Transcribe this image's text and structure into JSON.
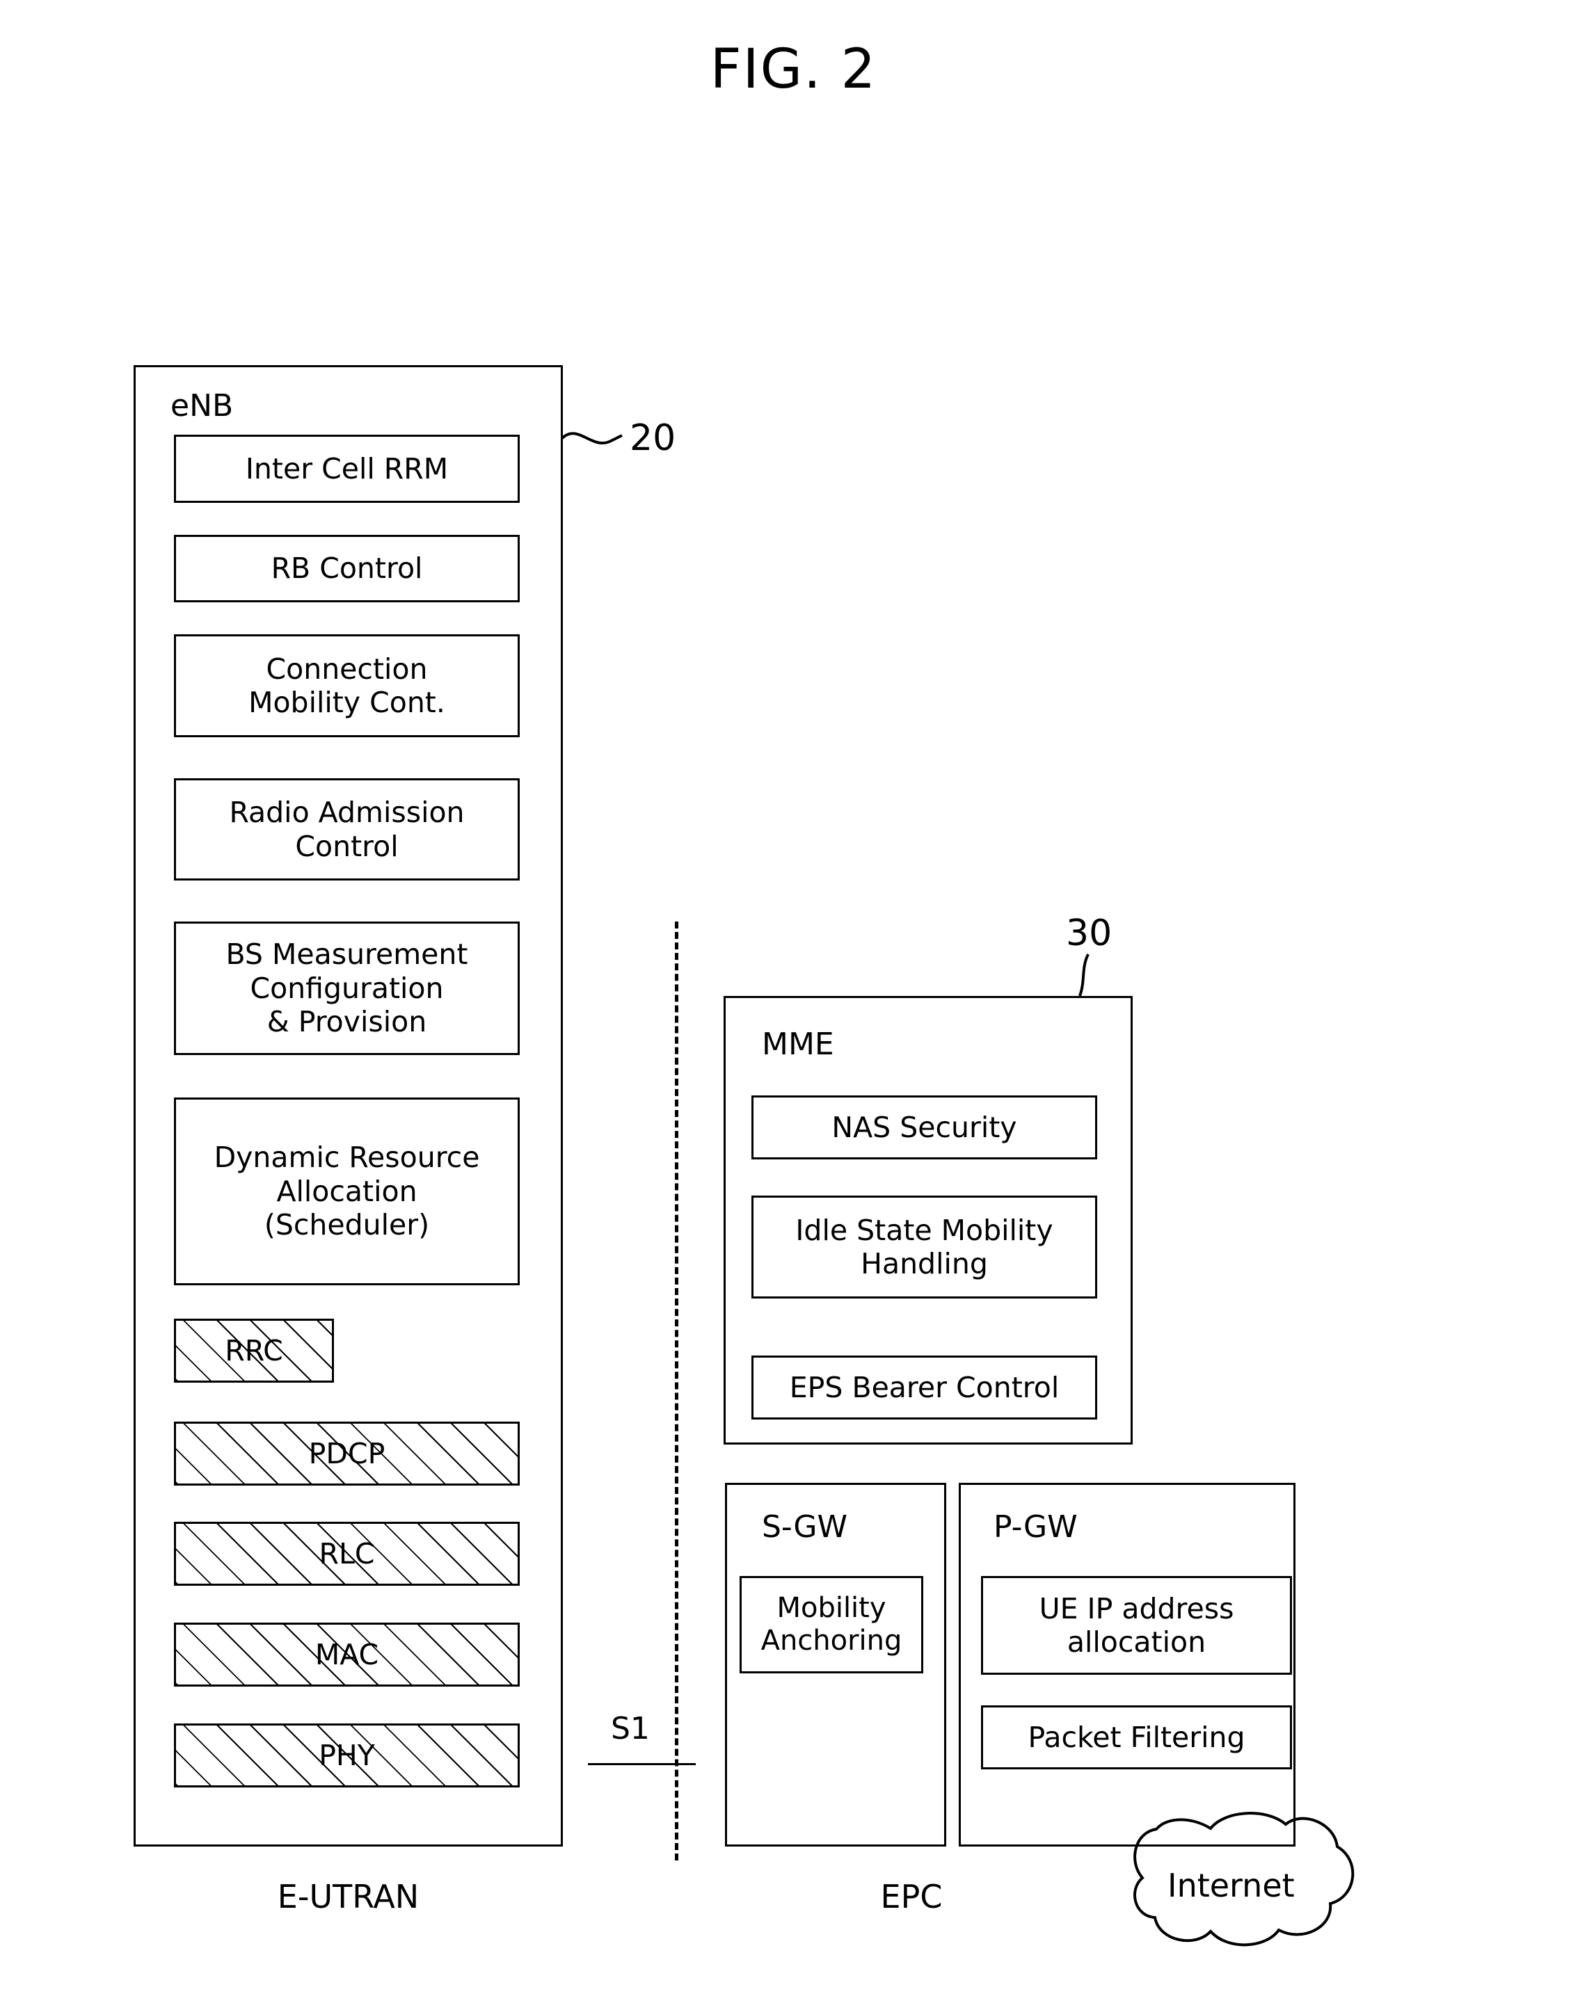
{
  "figure": {
    "title": "FIG. 2"
  },
  "reference_numerals": {
    "enb": "20",
    "epc_core": "30"
  },
  "interfaces": {
    "s1": "S1"
  },
  "enb": {
    "label": "eNB",
    "functions": [
      {
        "label": "Inter Cell RRM",
        "hatched": false
      },
      {
        "label": "RB Control",
        "hatched": false
      },
      {
        "label": "Connection\nMobility Cont.",
        "hatched": false
      },
      {
        "label": "Radio Admission\nControl",
        "hatched": false
      },
      {
        "label": "BS Measurement\nConfiguration\n& Provision",
        "hatched": false
      },
      {
        "label": "Dynamic Resource\nAllocation\n(Scheduler)",
        "hatched": false
      },
      {
        "label": "RRC",
        "hatched": true
      },
      {
        "label": "PDCP",
        "hatched": true
      },
      {
        "label": "RLC",
        "hatched": true
      },
      {
        "label": "MAC",
        "hatched": true
      },
      {
        "label": "PHY",
        "hatched": true
      }
    ]
  },
  "mme": {
    "label": "MME",
    "functions": [
      {
        "label": "NAS Security"
      },
      {
        "label": "Idle State Mobility\nHandling"
      },
      {
        "label": "EPS Bearer Control"
      }
    ]
  },
  "sgw": {
    "label": "S-GW",
    "functions": [
      {
        "label": "Mobility\nAnchoring"
      }
    ]
  },
  "pgw": {
    "label": "P-GW",
    "functions": [
      {
        "label": "UE IP address\nallocation"
      },
      {
        "label": "Packet Filtering"
      }
    ]
  },
  "internet": {
    "label": "Internet"
  },
  "captions": {
    "left": "E-UTRAN",
    "right": "EPC"
  },
  "colors": {
    "stroke": "#000000",
    "background": "#ffffff"
  }
}
